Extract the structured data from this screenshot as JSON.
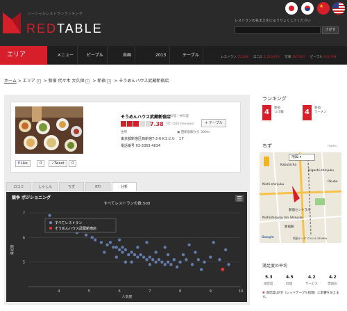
{
  "header": {
    "tagline": "ソーシャルレストランランキング",
    "brand_left": "RED",
    "brand_right": "TABLE",
    "search_prompt": "レストランの名まえをにゅうりょくしてください",
    "search_value": "",
    "search_button": "さがす"
  },
  "flags": [
    {
      "name": "japan-flag"
    },
    {
      "name": "korea-flag"
    },
    {
      "name": "china-flag"
    },
    {
      "name": "usa-flag"
    }
  ],
  "nav": {
    "active": "エリア",
    "items": [
      "メニュー",
      "ピープル",
      "自画",
      "2013",
      "テーブル"
    ],
    "stats": [
      {
        "label": "レストラン",
        "value": "75,208"
      },
      {
        "label": "ロコミ",
        "value": "1,210,674"
      },
      {
        "label": "写真",
        "value": "107,547"
      },
      {
        "label": "ピープル",
        "value": "133,794"
      }
    ]
  },
  "breadcrumb": [
    "ホーム",
    "エリア",
    "新宿 代々木 大久保",
    "新宿",
    "そうめんハウス武蔵新宿店"
  ],
  "restaurant": {
    "name": "そうめんハウス武蔵新宿店",
    "genre": "日本料理 / 丼料理",
    "score": "7.38",
    "score_sub": "RTI (581 Reviews)",
    "table_btn": "テーブル",
    "address_label": "住所",
    "distance": "西新宿駅から 300m",
    "address": "東京都新宿区西新宿7-2-6 K１ビル　１F",
    "tel": "電話番号 03-3363-4634",
    "rating": 3,
    "like": "Like",
    "like_count": "0",
    "tweet": "Tweet",
    "tweet_count": "0"
  },
  "tabs": [
    "ロコミ",
    "しゃしん",
    "ちず",
    "RTI",
    "分析"
  ],
  "chart_data": {
    "type": "scatter",
    "title": "競争 ポジショニング",
    "subtitle": "すべてレストランの数:500",
    "xlabel": "人気度",
    "ylabel": "満足度",
    "xlim": [
      3,
      10
    ],
    "ylim": [
      4,
      7
    ],
    "xticks": [
      4,
      5,
      6,
      7,
      8,
      9,
      10
    ],
    "yticks": [
      5,
      6,
      7
    ],
    "series": [
      {
        "name": "すべてレストラン",
        "color": "#6f8fc9",
        "points": [
          [
            3.7,
            6.9
          ],
          [
            3.9,
            6.7
          ],
          [
            4.1,
            6.6
          ],
          [
            4.3,
            6.5
          ],
          [
            4.5,
            6.3
          ],
          [
            4.6,
            6.2
          ],
          [
            4.9,
            6.1
          ],
          [
            5.1,
            6.0
          ],
          [
            5.2,
            5.9
          ],
          [
            5.4,
            5.8
          ],
          [
            5.6,
            5.7
          ],
          [
            5.7,
            5.8
          ],
          [
            5.8,
            5.6
          ],
          [
            5.9,
            5.6
          ],
          [
            6.0,
            5.5
          ],
          [
            6.1,
            5.6
          ],
          [
            6.1,
            5.4
          ],
          [
            6.2,
            5.5
          ],
          [
            6.3,
            5.3
          ],
          [
            6.4,
            5.4
          ],
          [
            6.5,
            5.3
          ],
          [
            6.6,
            5.2
          ],
          [
            6.7,
            5.3
          ],
          [
            6.8,
            5.2
          ],
          [
            6.9,
            5.1
          ],
          [
            7.0,
            5.2
          ],
          [
            7.1,
            5.1
          ],
          [
            7.2,
            5.0
          ],
          [
            7.3,
            5.1
          ],
          [
            7.4,
            5.0
          ],
          [
            7.5,
            4.9
          ],
          [
            7.6,
            5.0
          ],
          [
            7.7,
            4.9
          ],
          [
            7.8,
            5.1
          ],
          [
            8.0,
            5.0
          ],
          [
            8.2,
            5.1
          ],
          [
            8.4,
            4.9
          ],
          [
            8.6,
            5.1
          ],
          [
            8.8,
            5.0
          ],
          [
            9.0,
            5.2
          ],
          [
            9.3,
            5.1
          ],
          [
            9.6,
            4.9
          ],
          [
            6.9,
            5.8
          ],
          [
            7.5,
            5.6
          ],
          [
            8.3,
            5.7
          ],
          [
            9.1,
            5.8
          ],
          [
            5.5,
            5.4
          ],
          [
            6.2,
            5.0
          ],
          [
            7.9,
            4.8
          ],
          [
            8.7,
            4.7
          ],
          [
            7.2,
            5.4
          ],
          [
            6.0,
            5.9
          ],
          [
            6.6,
            5.6
          ],
          [
            7.0,
            4.9
          ],
          [
            8.1,
            5.3
          ],
          [
            9.5,
            5.5
          ],
          [
            5.9,
            5.2
          ],
          [
            6.4,
            5.0
          ],
          [
            7.6,
            5.3
          ],
          [
            8.5,
            5.4
          ]
        ]
      },
      {
        "name": "そうめんハウス武蔵新宿店",
        "color": "#e03a3a",
        "points": [
          [
            9.4,
            4.7
          ]
        ]
      }
    ]
  },
  "sidebar": {
    "ranking_title": "ランキング",
    "ranks": [
      {
        "num": "4",
        "line1": "新宿",
        "line2": "つけ麺"
      },
      {
        "num": "4",
        "line1": "新宿",
        "line2": "ラーメン"
      }
    ],
    "map_title": "ちず",
    "more": "more",
    "map_select": "地図",
    "map_labels": [
      "Kabukicho",
      "Higashi-shinjuku",
      "Nishi-shinjuku",
      "Nishishinjuku Inn Shinjuku",
      "Okubo",
      "新宿セントラル",
      "新宿駅",
      "Google",
      "地図データ ©2014 ZENRIN"
    ],
    "sat_title": "満足度の平均",
    "sat": [
      {
        "v": "5.3",
        "l": "満足度"
      },
      {
        "v": "4.5",
        "l": "料理"
      },
      {
        "v": "4.2",
        "l": "サービス"
      },
      {
        "v": "4.2",
        "l": "雰囲気"
      }
    ],
    "note": "満足度はRTI（レッドテーブル指数）に影響を与えます。"
  }
}
